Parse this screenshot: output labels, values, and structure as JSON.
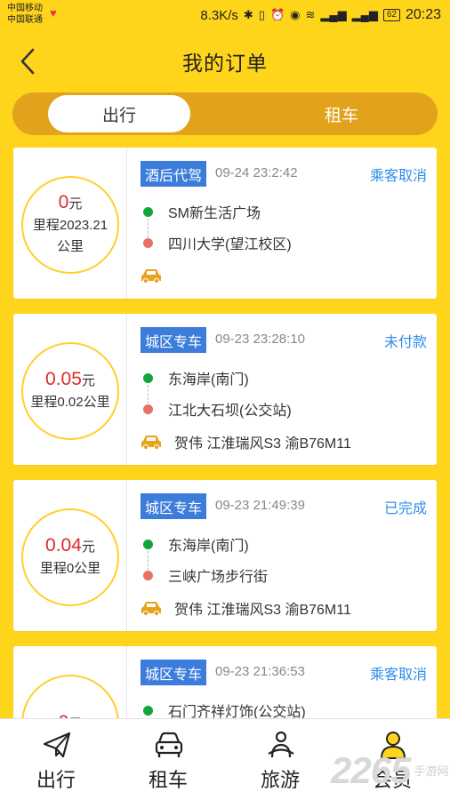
{
  "status_bar": {
    "carrier1": "中国移动",
    "carrier2": "中国联通",
    "speed": "8.3K/s",
    "battery": "62",
    "time": "20:23"
  },
  "header": {
    "title": "我的订单"
  },
  "tabs": {
    "active": "出行",
    "inactive": "租车"
  },
  "orders": [
    {
      "amount": "0",
      "unit": "元",
      "mileage": "里程2023.21公里",
      "service": "酒后代驾",
      "time": "09-24 23:2:42",
      "status": "乘客取消",
      "from": "SM新生活广场",
      "to": "四川大学(望江校区)",
      "driver": ""
    },
    {
      "amount": "0.05",
      "unit": "元",
      "mileage": "里程0.02公里",
      "service": "城区专车",
      "time": "09-23 23:28:10",
      "status": "未付款",
      "from": "东海岸(南门)",
      "to": "江北大石坝(公交站)",
      "driver": "贺伟 江淮瑞风S3 渝B76M11"
    },
    {
      "amount": "0.04",
      "unit": "元",
      "mileage": "里程0公里",
      "service": "城区专车",
      "time": "09-23 21:49:39",
      "status": "已完成",
      "from": "东海岸(南门)",
      "to": "三峡广场步行街",
      "driver": "贺伟 江淮瑞风S3 渝B76M11"
    },
    {
      "amount": "0",
      "unit": "元",
      "mileage": "",
      "service": "城区专车",
      "time": "09-23 21:36:53",
      "status": "乘客取消",
      "from": "石门齐祥灯饰(公交站)",
      "to": "",
      "driver": ""
    }
  ],
  "nav": {
    "items": [
      {
        "label": "出行",
        "icon": "paper-plane-icon"
      },
      {
        "label": "租车",
        "icon": "car-icon"
      },
      {
        "label": "旅游",
        "icon": "traveler-icon"
      },
      {
        "label": "会员",
        "icon": "member-icon"
      }
    ]
  },
  "watermark": {
    "number": "2265",
    "line1": "手游网",
    "line2": ""
  },
  "colors": {
    "background": "#FFD51C",
    "segment": "#E2A21B",
    "badge": "#3C7CDB",
    "status": "#2F8EEA",
    "amount": "#E02A2A",
    "dot_start": "#12A63A",
    "dot_end": "#E87064",
    "car": "#E9A21C"
  }
}
